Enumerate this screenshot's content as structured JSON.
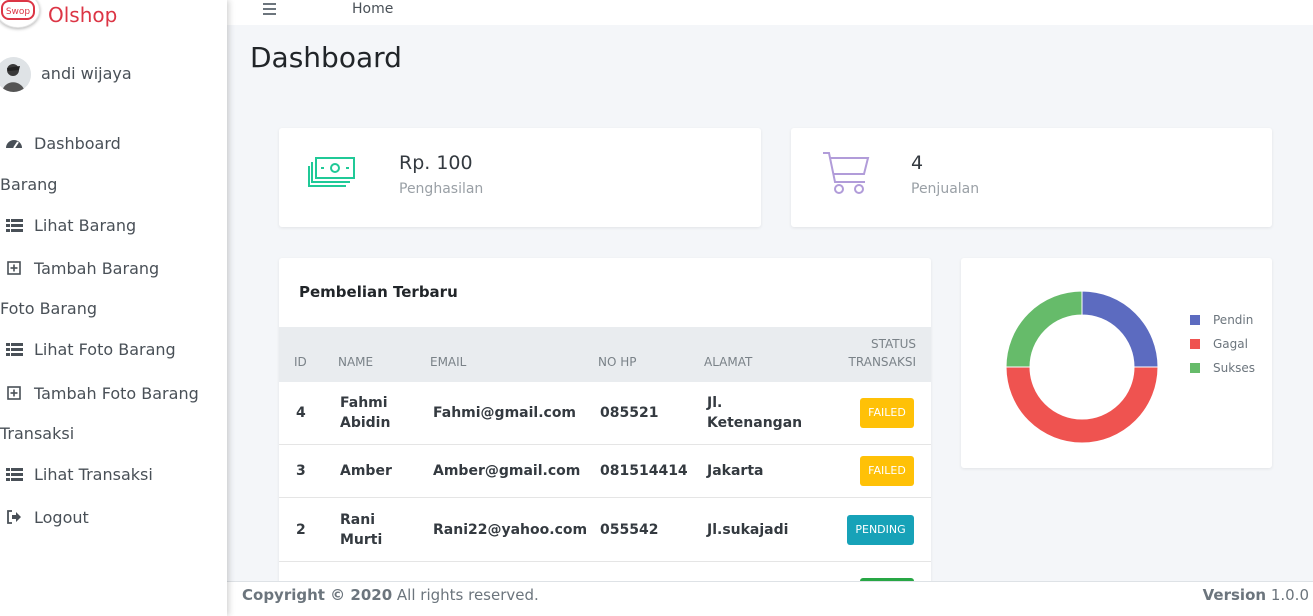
{
  "brand": {
    "logo_text": "Swop",
    "name": "Olshop",
    "color": "#dc3545"
  },
  "user": {
    "name": "andi wijaya"
  },
  "sidebar": {
    "dashboard": {
      "label": "Dashboard",
      "icon": "tachometer-icon"
    },
    "barang_header": "Barang",
    "lihat_barang": {
      "label": "Lihat Barang",
      "icon": "list-icon"
    },
    "tambah_barang": {
      "label": "Tambah Barang",
      "icon": "plus-square-icon"
    },
    "foto_header": "Foto Barang",
    "lihat_foto": {
      "label": "Lihat Foto Barang",
      "icon": "list-icon"
    },
    "tambah_foto": {
      "label": "Tambah Foto Barang",
      "icon": "plus-square-icon"
    },
    "transaksi_header": "Transaksi",
    "lihat_transaksi": {
      "label": "Lihat Transaksi",
      "icon": "list-icon"
    },
    "logout": {
      "label": "Logout",
      "icon": "sign-out-icon"
    }
  },
  "topnav": {
    "home": "Home",
    "menu_icon": "hamburger-icon"
  },
  "page": {
    "title": "Dashboard"
  },
  "stats": {
    "income": {
      "value": "Rp. 100",
      "label": "Penghasilan",
      "icon": "money-icon",
      "color": "#20c997"
    },
    "sales": {
      "value": "4",
      "label": "Penjualan",
      "icon": "cart-icon",
      "color": "#b19cd9"
    }
  },
  "table": {
    "title": "Pembelian Terbaru",
    "headers": {
      "id": "ID",
      "name": "NAME",
      "email": "EMAIL",
      "phone": "NO HP",
      "address": "ALAMAT",
      "status_1": "STATUS",
      "status_2": "TRANSAKSI"
    },
    "rows": [
      {
        "id": "4",
        "name_1": "Fahmi",
        "name_2": "Abidin",
        "email": "Fahmi@gmail.com",
        "phone": "085521",
        "addr_1": "Jl.",
        "addr_2": "Ketenangan",
        "status": "FAILED",
        "status_color": "#ffc107"
      },
      {
        "id": "3",
        "name_1": "Amber",
        "name_2": "",
        "email": "Amber@gmail.com",
        "phone": "081514414",
        "addr_1": "Jakarta",
        "addr_2": "",
        "status": "FAILED",
        "status_color": "#ffc107"
      },
      {
        "id": "2",
        "name_1": "Rani",
        "name_2": "Murti",
        "email": "Rani22@yahoo.com",
        "phone": "055542",
        "addr_1": "Jl.sukajadi",
        "addr_2": "",
        "status": "PENDING",
        "status_color": "#17a2b8"
      }
    ]
  },
  "chart_data": {
    "type": "pie",
    "title": "",
    "categories": [
      "Pendin",
      "Gagal",
      "Sukses"
    ],
    "values": [
      1,
      2,
      1
    ],
    "colors": [
      "#5c6bc0",
      "#ef5350",
      "#66bb6a"
    ],
    "legend": "right"
  },
  "footer": {
    "copyright": "Copyright © 2020",
    "rights": " All rights reserved.",
    "version_label": "Version",
    "version": " 1.0.0"
  }
}
